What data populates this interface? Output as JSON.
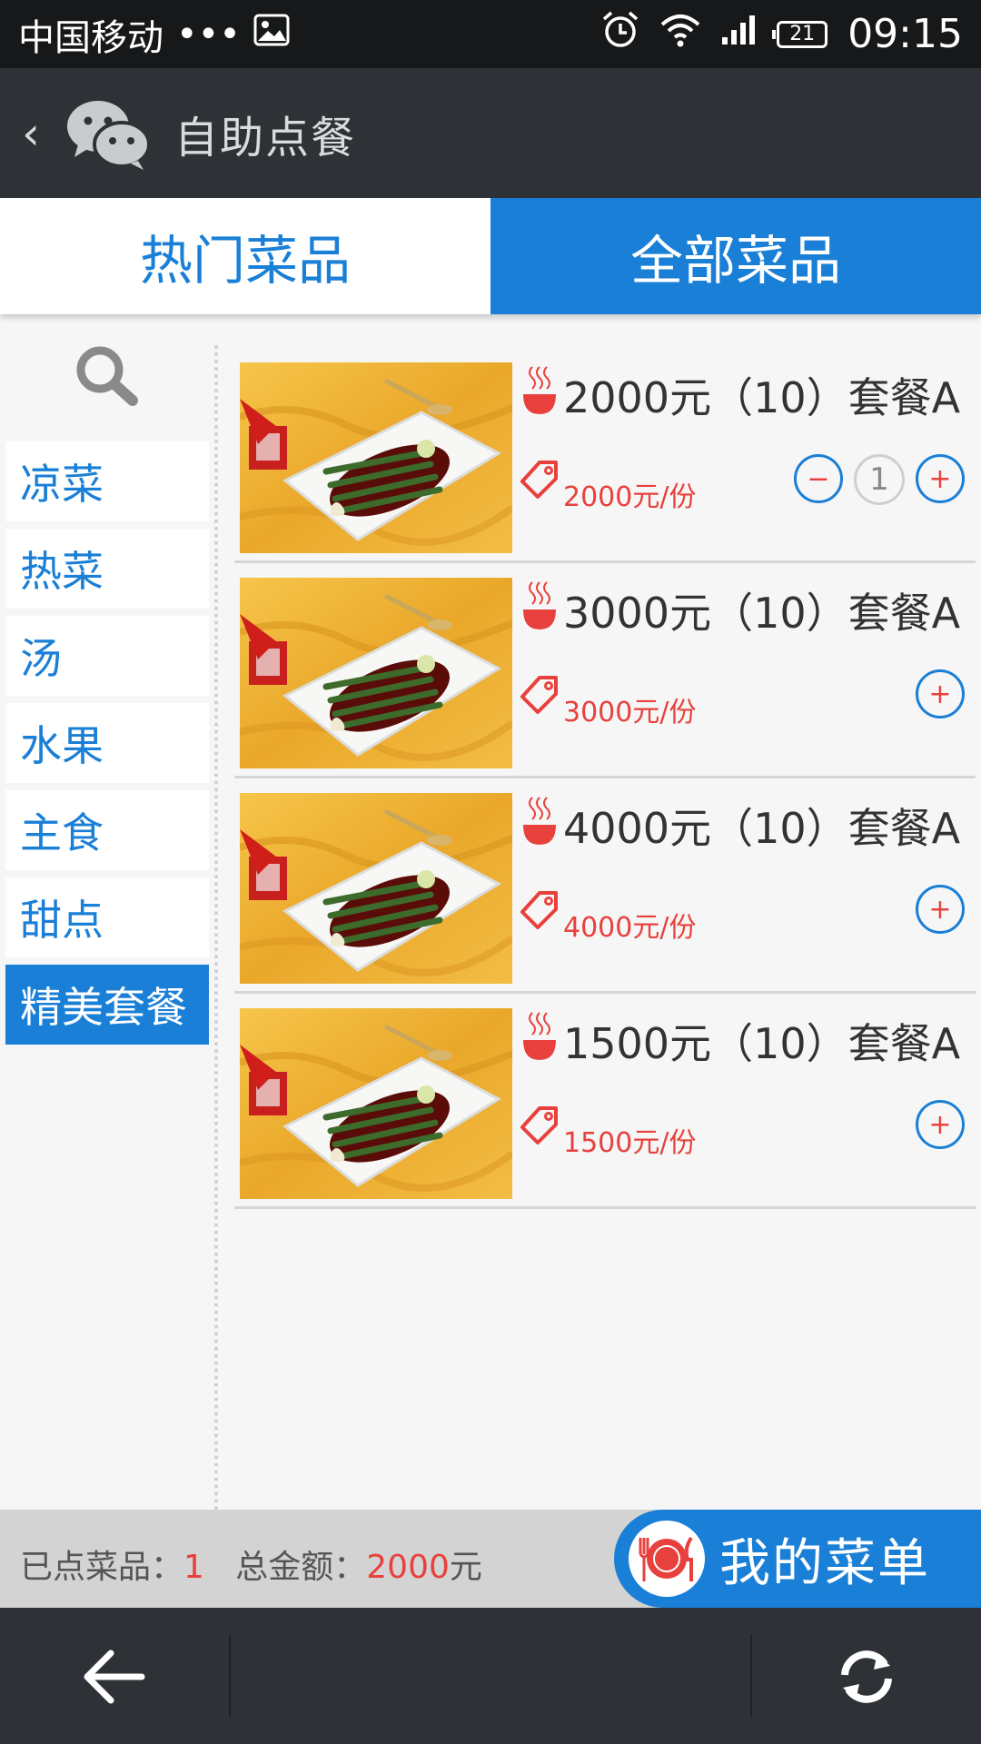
{
  "status_bar": {
    "carrier": "中国移动",
    "dots": "•••",
    "battery": "21",
    "time": "09:15"
  },
  "app_bar": {
    "back_glyph": "‹",
    "title": "自助点餐"
  },
  "tabs": [
    {
      "label": "热门菜品",
      "active": false
    },
    {
      "label": "全部菜品",
      "active": true
    }
  ],
  "categories": [
    {
      "label": "凉菜",
      "active": false
    },
    {
      "label": "热菜",
      "active": false
    },
    {
      "label": "汤",
      "active": false
    },
    {
      "label": "水果",
      "active": false
    },
    {
      "label": "主食",
      "active": false
    },
    {
      "label": "甜点",
      "active": false
    },
    {
      "label": "精美套餐",
      "active": true
    }
  ],
  "dishes": [
    {
      "name": "2000元（10）套餐A",
      "price": "2000元/份",
      "quantity": "1"
    },
    {
      "name": "3000元（10）套餐A",
      "price": "3000元/份",
      "quantity": ""
    },
    {
      "name": "4000元（10）套餐A",
      "price": "4000元/份",
      "quantity": ""
    },
    {
      "name": "1500元（10）套餐A",
      "price": "1500元/份",
      "quantity": ""
    }
  ],
  "controls": {
    "minus": "−",
    "plus": "+"
  },
  "summary": {
    "ordered_label": "已点菜品：",
    "ordered_count": "1",
    "total_label": "总金额：",
    "total_amount": "2000",
    "currency": "元"
  },
  "my_menu": {
    "label": "我的菜单"
  },
  "icons": {
    "search": "search-icon",
    "steam": "steam-bowl-icon",
    "tag": "price-tag-icon",
    "plate": "plate-cutlery-icon",
    "back_arrow": "arrow-left-icon",
    "refresh": "refresh-icon"
  },
  "colors": {
    "accent": "#1a7fd6",
    "price": "#e8413d",
    "header": "#2e3236"
  }
}
